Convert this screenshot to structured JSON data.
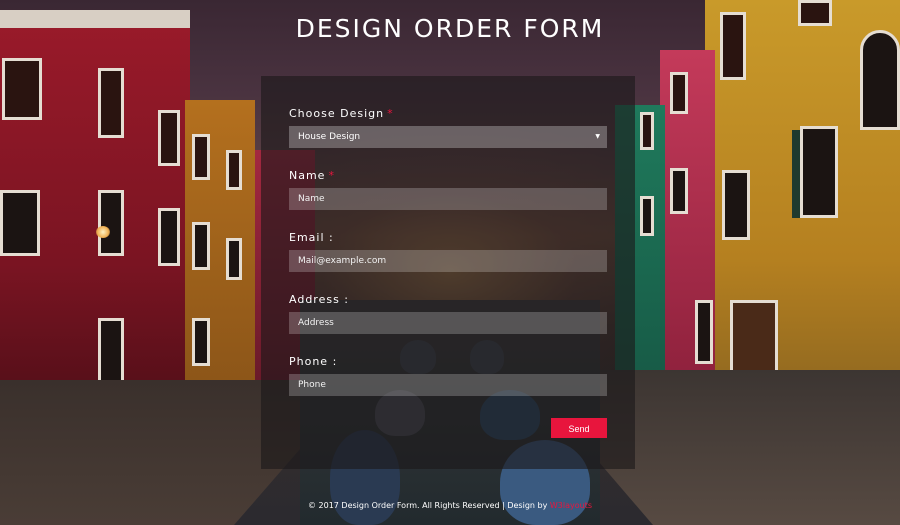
{
  "page": {
    "title": "DESIGN ORDER FORM"
  },
  "form": {
    "design": {
      "label": "Choose Design",
      "required_mark": "*",
      "selected": "House Design",
      "arrow_icon": "caret-down-icon"
    },
    "name": {
      "label": "Name",
      "required_mark": "*",
      "placeholder": "Name"
    },
    "email": {
      "label": "Email :",
      "placeholder": "Mail@example.com"
    },
    "address": {
      "label": "Address :",
      "placeholder": "Address"
    },
    "phone": {
      "label": "Phone :",
      "placeholder": "Phone"
    },
    "submit_label": "Send"
  },
  "footer": {
    "text": "© 2017 Design Order Form. All Rights Reserved | Design by",
    "brand": "W3layouts"
  },
  "colors": {
    "accent": "#e8153d",
    "text": "#ffffff"
  }
}
